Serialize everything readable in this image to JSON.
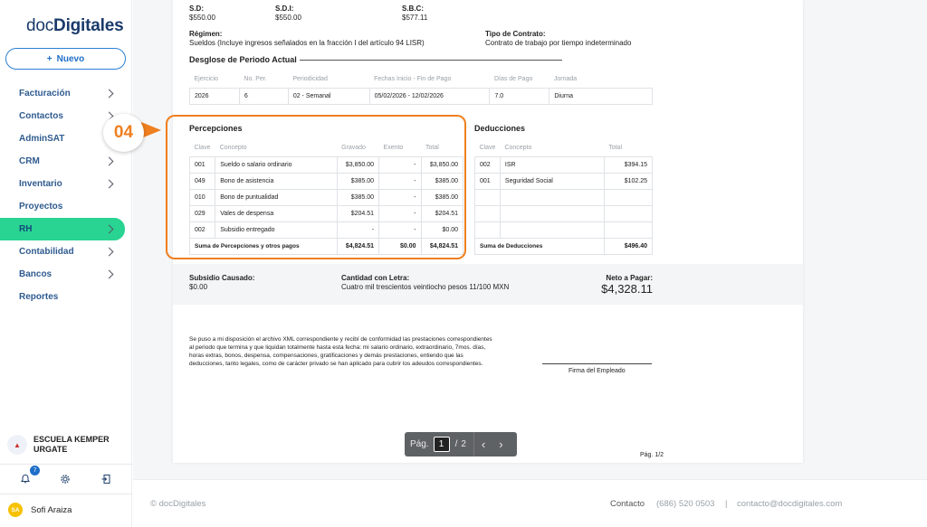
{
  "sidebar": {
    "logo_prefix": "doc",
    "logo_bold": "Digitales",
    "new_button": "Nuevo",
    "items": [
      {
        "label": "Facturación",
        "chevron": true
      },
      {
        "label": "Contactos",
        "chevron": true
      },
      {
        "label": "AdminSAT",
        "chevron": false
      },
      {
        "label": "CRM",
        "chevron": true
      },
      {
        "label": "Inventario",
        "chevron": true
      },
      {
        "label": "Proyectos",
        "chevron": false
      },
      {
        "label": "RH",
        "chevron": true,
        "active": true
      },
      {
        "label": "Contabilidad",
        "chevron": true
      },
      {
        "label": "Bancos",
        "chevron": true
      },
      {
        "label": "Reportes",
        "chevron": false
      }
    ],
    "school_name": "ESCUELA KEMPER URGATE",
    "notifications": "7",
    "user_initials": "SA",
    "user_name": "Sofi Araiza"
  },
  "doc": {
    "sd_label": "S.D:",
    "sd_value": "$550.00",
    "sdi_label": "S.D.I:",
    "sdi_value": "$550.00",
    "sbc_label": "S.B.C:",
    "sbc_value": "$577.11",
    "regimen_label": "Régimen:",
    "regimen_value": "Sueldos (Incluye ingresos señalados en la fracción I del artículo 94 LISR)",
    "contrato_label": "Tipo de Contrato:",
    "contrato_value": "Contrato de trabajo por tiempo indeterminado",
    "desglose_title": "Desglose de Periodo Actual",
    "periodo_headers": [
      "Ejercicio",
      "No. Per.",
      "Periodicidad",
      "Fechas Inicio - Fin de Pago",
      "Días de Pago",
      "Jornada"
    ],
    "periodo_row": [
      "2026",
      "6",
      "02 - Semanal",
      "05/02/2026 - 12/02/2026",
      "7.0",
      "Diurna"
    ],
    "percepciones_title": "Percepciones",
    "perc_headers": [
      "Clave",
      "Concepto",
      "Gravado",
      "Exento",
      "Total"
    ],
    "perc_rows": [
      [
        "001",
        "Sueldo o salario ordinario",
        "$3,850.00",
        "-",
        "$3,850.00"
      ],
      [
        "049",
        "Bono de asistencia",
        "$385.00",
        "-",
        "$385.00"
      ],
      [
        "010",
        "Bono de puntualidad",
        "$385.00",
        "-",
        "$385.00"
      ],
      [
        "029",
        "Vales de despensa",
        "$204.51",
        "-",
        "$204.51"
      ],
      [
        "002",
        "Subsidio entregado",
        "-",
        "-",
        "$0.00"
      ]
    ],
    "perc_total_label": "Suma de Percepciones y otros pagos",
    "perc_total": [
      "$4,824.51",
      "$0.00",
      "$4,824.51"
    ],
    "deducciones_title": "Deducciones",
    "ded_headers": [
      "Clave",
      "Concepto",
      "Total"
    ],
    "ded_rows": [
      [
        "002",
        "ISR",
        "$394.15"
      ],
      [
        "001",
        "Seguridad Social",
        "$102.25"
      ],
      [
        "",
        "",
        ""
      ],
      [
        "",
        "",
        ""
      ],
      [
        "",
        "",
        ""
      ]
    ],
    "ded_total_label": "Suma de Deducciones",
    "ded_total": "$496.40",
    "subsidio_label": "Subsidio Causado:",
    "subsidio_value": "$0.00",
    "cantidad_label": "Cantidad con Letra:",
    "cantidad_value": "Cuatro mil trescientos veintiocho pesos 11/100 MXN",
    "neto_label": "Neto a Pagar:",
    "neto_value": "$4,328.11",
    "disclaimer": [
      "Se puso a mi disposición el archivo XML correspondiente y recibí de conformidad las prestaciones correspondientes",
      "al periodo que termina y que liquidan totalmente hasta esta fecha: mi salario ordinario, extraordinario, 7mos. días,",
      "horas extras, bonos, despensa, compensaciones, gratificaciones y demás prestaciones, entiendo que las",
      "deducciones, tanto legales, como de carácter privado se han aplicado para cubrir los adeudos correspondientes."
    ],
    "firma_label": "Firma del Empleado",
    "page_footer": "Pág. 1/2"
  },
  "pager": {
    "label": "Pág.",
    "current": "1",
    "separator": "/",
    "total": "2"
  },
  "callout": "04",
  "footer": {
    "copyright": "© docDigitales",
    "contacto_label": "Contacto",
    "phone": "(686) 520 0503",
    "divider": "|",
    "email": "contacto@docdigitales.com"
  },
  "colors": {
    "accent": "#29d392",
    "brand": "#1f6fc7",
    "callout": "#ef7f1f"
  }
}
